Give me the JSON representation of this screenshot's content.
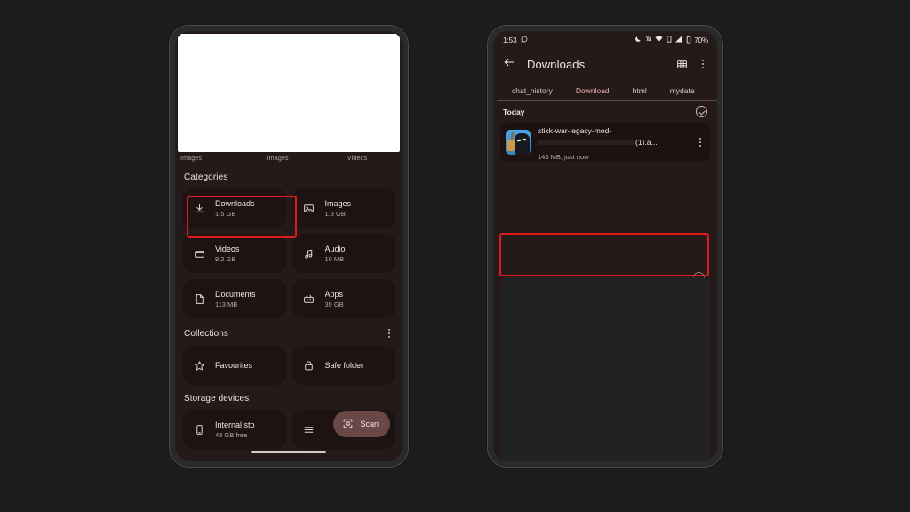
{
  "background_color": "#1c1c1c",
  "left_phone": {
    "name": "files-app-home",
    "carousel": {
      "labels": [
        "Images",
        "Images",
        "Videos"
      ]
    },
    "sections": {
      "categories": {
        "title": "Categories",
        "tiles": [
          {
            "icon": "download-icon",
            "name": "Downloads",
            "size": "1.5 GB",
            "highlighted": true
          },
          {
            "icon": "image-icon",
            "name": "Images",
            "size": "1.8 GB",
            "highlighted": false
          },
          {
            "icon": "video-icon",
            "name": "Videos",
            "size": "9.2 GB",
            "highlighted": false
          },
          {
            "icon": "audio-icon",
            "name": "Audio",
            "size": "10 MB",
            "highlighted": false
          },
          {
            "icon": "document-icon",
            "name": "Documents",
            "size": "113 MB",
            "highlighted": false
          },
          {
            "icon": "apps-icon",
            "name": "Apps",
            "size": "39 GB",
            "highlighted": false
          }
        ]
      },
      "collections": {
        "title": "Collections",
        "overflow_icon": "more-vertical-icon",
        "tiles": [
          {
            "icon": "star-icon",
            "name": "Favourites"
          },
          {
            "icon": "lock-icon",
            "name": "Safe folder"
          }
        ]
      },
      "storage_devices": {
        "title": "Storage devices",
        "tiles": [
          {
            "icon": "phone-icon",
            "name": "Internal sto",
            "size": "48 GB free"
          },
          {
            "icon": "list-icon",
            "name": "",
            "size": ""
          }
        ]
      }
    },
    "fab": {
      "icon": "scan-icon",
      "label": "Scan"
    },
    "highlight_color": "#e01b1b"
  },
  "right_phone": {
    "name": "files-app-downloads",
    "status_bar": {
      "time": "1:53",
      "left_icons": [
        "whatsapp-icon"
      ],
      "right_icons": [
        "do-not-disturb-icon",
        "notifications-off-icon",
        "wifi-icon",
        "sim-icon",
        "signal-icon",
        "battery-icon"
      ],
      "battery": "70%"
    },
    "app_bar": {
      "back_icon": "back-arrow-icon",
      "title": "Downloads",
      "actions": [
        "grid-view-icon",
        "more-vertical-icon"
      ]
    },
    "tabs": [
      {
        "label": "",
        "active": false
      },
      {
        "label": "chat_history",
        "active": false
      },
      {
        "label": "Download",
        "active": true
      },
      {
        "label": "html",
        "active": false
      },
      {
        "label": "mydata",
        "active": false
      }
    ],
    "list": {
      "group_header": "Today",
      "select_all_icon": "check-circle-icon",
      "items": [
        {
          "thumbnail": "stick-war-app-icon",
          "name_line1": "stick-war-legacy-mod-",
          "name_line2_redacted": true,
          "name_line2_tail": "(1).a...",
          "meta": "143 MB, just now",
          "overflow_icon": "more-vertical-icon",
          "highlighted": true
        }
      ]
    },
    "highlight_color": "#e01b1b"
  }
}
